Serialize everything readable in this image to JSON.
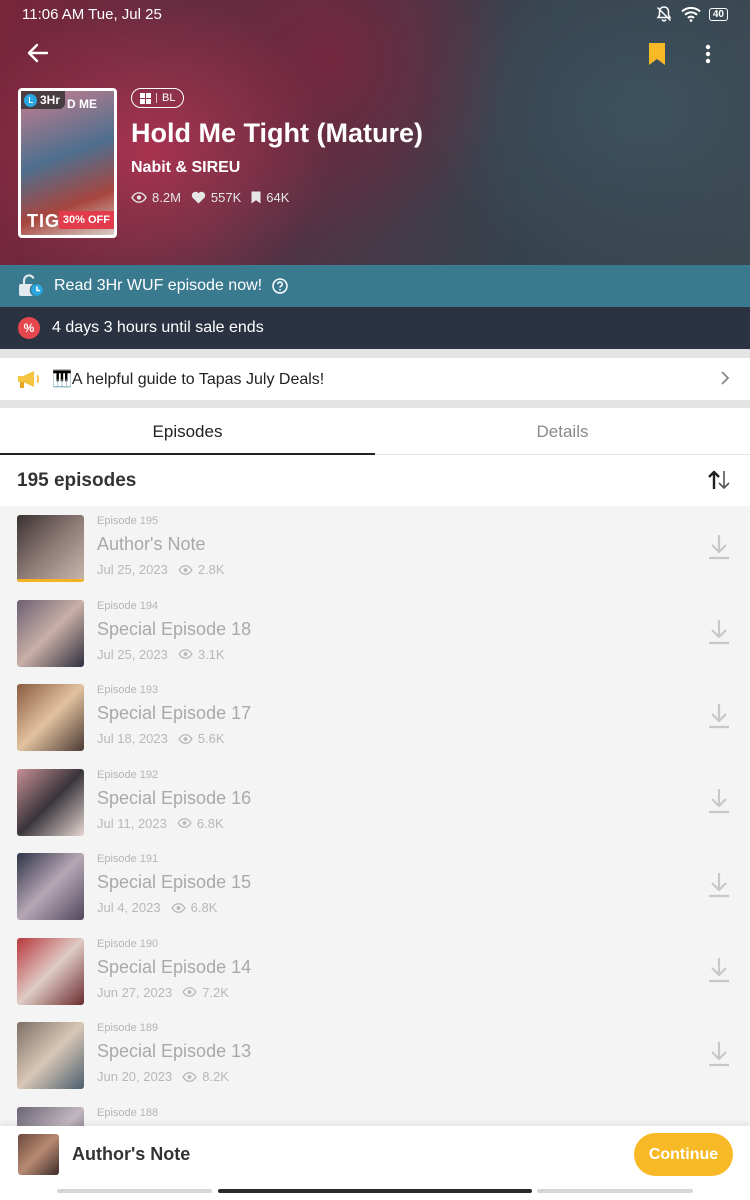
{
  "status_bar": {
    "time": "11:06 AM Tue, Jul 25",
    "battery": "40"
  },
  "series": {
    "title": "Hold Me Tight (Mature)",
    "authors": "Nabit  & SIREU",
    "genre": "BL",
    "views": "8.2M",
    "likes": "557K",
    "subscribers": "64K",
    "cover": {
      "badge": "3Hr",
      "discount": "30% OFF",
      "cover_text_top": "D ME",
      "cover_text_bottom": "TIG"
    }
  },
  "promos": {
    "wuf_text": "Read 3Hr WUF episode now!",
    "sale_icon": "%",
    "sale_text": "4 days 3 hours until sale ends",
    "guide_text": "🎹A helpful guide to Tapas July Deals!"
  },
  "tabs": [
    {
      "label": "Episodes",
      "active": true
    },
    {
      "label": "Details",
      "active": false
    }
  ],
  "episode_count": "195 episodes",
  "episodes": [
    {
      "number": "Episode 195",
      "title": "Author's Note",
      "date": "Jul 25, 2023",
      "views": "2.8K",
      "progress": 1.0,
      "colors": [
        "#3a3132",
        "#8d7a76",
        "#c9b7ae"
      ]
    },
    {
      "number": "Episode 194",
      "title": "Special Episode 18",
      "date": "Jul 25, 2023",
      "views": "3.1K",
      "progress": 0,
      "colors": [
        "#6d5f73",
        "#c9b0a6",
        "#2f2f3f"
      ]
    },
    {
      "number": "Episode 193",
      "title": "Special Episode 17",
      "date": "Jul 18, 2023",
      "views": "5.6K",
      "progress": 0,
      "colors": [
        "#8a5b3f",
        "#e2c29f",
        "#4b3a33"
      ]
    },
    {
      "number": "Episode 192",
      "title": "Special Episode 16",
      "date": "Jul 11, 2023",
      "views": "6.8K",
      "progress": 0,
      "colors": [
        "#c98f96",
        "#39353b",
        "#e6d7d2"
      ]
    },
    {
      "number": "Episode 191",
      "title": "Special Episode 15",
      "date": "Jul 4, 2023",
      "views": "6.8K",
      "progress": 0,
      "colors": [
        "#2f3447",
        "#b6a7b5",
        "#51485c"
      ]
    },
    {
      "number": "Episode 190",
      "title": "Special Episode 14",
      "date": "Jun 27, 2023",
      "views": "7.2K",
      "progress": 0,
      "colors": [
        "#b7383d",
        "#e0cbc4",
        "#6a2b2e"
      ]
    },
    {
      "number": "Episode 189",
      "title": "Special Episode 13",
      "date": "Jun 20, 2023",
      "views": "8.2K",
      "progress": 0,
      "colors": [
        "#7d6f66",
        "#d9c7b5",
        "#4b5f6e"
      ]
    },
    {
      "number": "Episode 188",
      "title": "",
      "date": "",
      "views": "",
      "progress": 0,
      "colors": [
        "#6a6473",
        "#c2b7c0",
        "#3e3a47"
      ]
    }
  ],
  "bottom_bar": {
    "title": "Author's Note",
    "continue_label": "Continue"
  },
  "colors": {
    "accent": "#f8b926",
    "wuf_bar": "#3a7a8f",
    "sale_bar": "#2b3342",
    "sale_icon": "#e5474c"
  }
}
